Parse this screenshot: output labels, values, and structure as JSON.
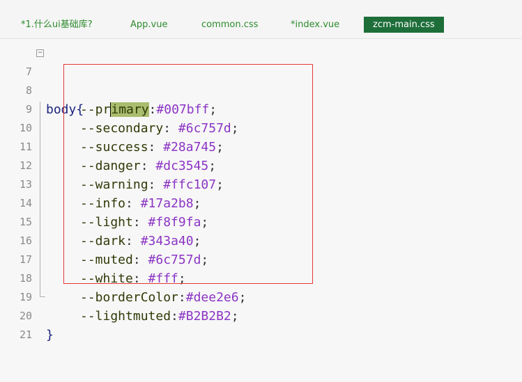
{
  "tabs": [
    {
      "label": "*1.什么ui基础库?",
      "active": false
    },
    {
      "label": "App.vue",
      "active": false
    },
    {
      "label": "common.css",
      "active": false
    },
    {
      "label": "*index.vue",
      "active": false
    },
    {
      "label": "zcm-main.css",
      "active": true
    }
  ],
  "editor": {
    "lines": [
      {
        "num": "7",
        "code": "body{"
      },
      {
        "num": "8",
        "prop": "--primary",
        "sep": ":",
        "val": "#007bff",
        "end": ";"
      },
      {
        "num": "9",
        "prop": "--secondary",
        "sep": ": ",
        "val": "#6c757d",
        "end": ";"
      },
      {
        "num": "10",
        "prop": "--success",
        "sep": ": ",
        "val": "#28a745",
        "end": ";"
      },
      {
        "num": "11",
        "prop": "--danger",
        "sep": ": ",
        "val": "#dc3545",
        "end": ";"
      },
      {
        "num": "12",
        "prop": "--warning",
        "sep": ": ",
        "val": "#ffc107",
        "end": ";"
      },
      {
        "num": "13",
        "prop": "--info",
        "sep": ": ",
        "val": "#17a2b8",
        "end": ";"
      },
      {
        "num": "14",
        "prop": "--light",
        "sep": ": ",
        "val": "#f8f9fa",
        "end": ";"
      },
      {
        "num": "15",
        "prop": "--dark",
        "sep": ": ",
        "val": "#343a40",
        "end": ";"
      },
      {
        "num": "16",
        "prop": "--muted",
        "sep": ": ",
        "val": "#6c757d",
        "end": ";"
      },
      {
        "num": "17",
        "prop": "--white",
        "sep": ": ",
        "val": "#fff",
        "end": ";"
      },
      {
        "num": "18",
        "prop": "--borderColor",
        "sep": ":",
        "val": "#dee2e6",
        "end": ";"
      },
      {
        "num": "19",
        "prop": "--lightmuted",
        "sep": ":",
        "val": "#B2B2B2",
        "end": ";"
      },
      {
        "num": "20",
        "code": "}"
      },
      {
        "num": "21",
        "code": ""
      }
    ],
    "primary_prefix": "--pr",
    "primary_highlight": "imary",
    "fold_glyph": "−"
  },
  "colors": {
    "tab_text": "#2e8b2e",
    "tab_active_bg": "#1e6e3a",
    "property": "#2f3a07",
    "value": "#8b34c4",
    "selector": "#1a237e",
    "annotation_box": "#e53935"
  }
}
